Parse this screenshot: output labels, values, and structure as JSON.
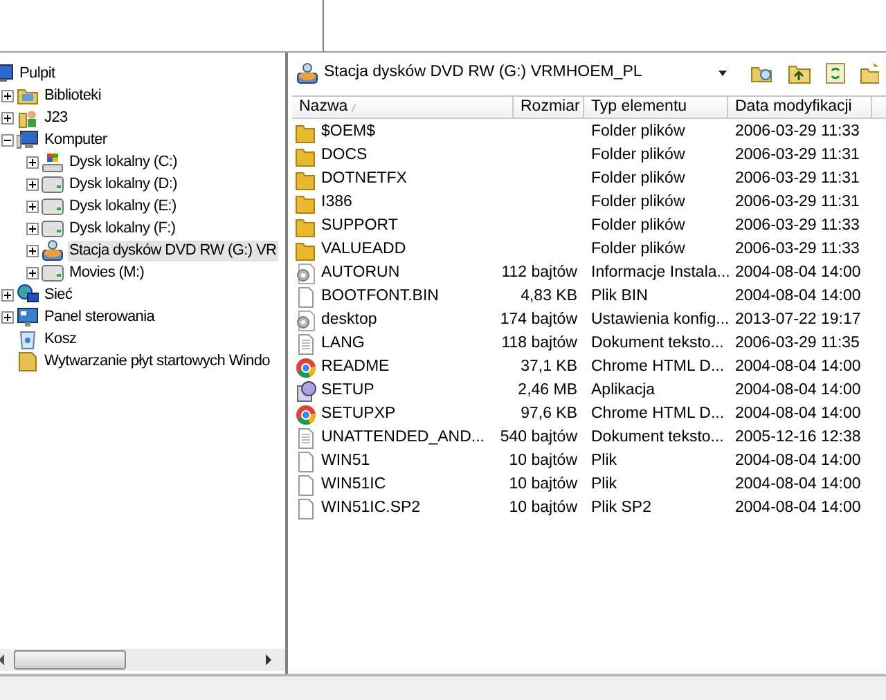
{
  "tree": [
    {
      "label": "Pulpit",
      "kind": "desktop",
      "selected": false,
      "children": [
        {
          "label": "Biblioteki",
          "kind": "library",
          "expanded": false,
          "selected": false
        },
        {
          "label": "J23",
          "kind": "user",
          "expanded": false,
          "selected": false
        },
        {
          "label": "Komputer",
          "kind": "computer",
          "expanded": true,
          "selected": false,
          "children": [
            {
              "label": "Dysk lokalny (C:)",
              "kind": "windrive",
              "expanded": false,
              "selected": false
            },
            {
              "label": "Dysk lokalny (D:)",
              "kind": "drive",
              "expanded": false,
              "selected": false
            },
            {
              "label": "Dysk lokalny (E:)",
              "kind": "drive",
              "expanded": false,
              "selected": false
            },
            {
              "label": "Dysk lokalny (F:)",
              "kind": "drive",
              "expanded": false,
              "selected": false
            },
            {
              "label": "Stacja dysków DVD RW (G:) VR",
              "kind": "dvd",
              "expanded": false,
              "selected": true
            },
            {
              "label": "Movies (M:)",
              "kind": "drive",
              "expanded": false,
              "selected": false
            }
          ]
        },
        {
          "label": "Sieć",
          "kind": "network",
          "expanded": false,
          "selected": false
        },
        {
          "label": "Panel sterowania",
          "kind": "control",
          "expanded": false,
          "selected": false
        },
        {
          "label": "Kosz",
          "kind": "trash",
          "selected": false
        },
        {
          "label": "Wytwarzanie płyt startowych Windo",
          "kind": "folder",
          "selected": false
        }
      ]
    }
  ],
  "location": {
    "value": "Stacja dysków DVD RW (G:) VRMHOEM_PL"
  },
  "columns": [
    "Nazwa",
    "Rozmiar",
    "Typ elementu",
    "Data modyfikacji"
  ],
  "rows": [
    {
      "kind": "folder",
      "name": "$OEM$",
      "type": "Folder plików",
      "date": "2006-03-29 11:33"
    },
    {
      "kind": "folder",
      "name": "DOCS",
      "type": "Folder plików",
      "date": "2006-03-29 11:31"
    },
    {
      "kind": "folder",
      "name": "DOTNETFX",
      "type": "Folder plików",
      "date": "2006-03-29 11:31"
    },
    {
      "kind": "folder",
      "name": "I386",
      "type": "Folder plików",
      "date": "2006-03-29 11:31"
    },
    {
      "kind": "folder",
      "name": "SUPPORT",
      "type": "Folder plików",
      "date": "2006-03-29 11:33"
    },
    {
      "kind": "folder",
      "name": "VALUEADD",
      "type": "Folder plików",
      "date": "2006-03-29 11:33"
    },
    {
      "kind": "config",
      "name": "AUTORUN",
      "size": "112 bajtów",
      "type": "Informacje Instala...",
      "date": "2004-08-04 14:00"
    },
    {
      "kind": "file",
      "name": "BOOTFONT.BIN",
      "size": "4,83 KB",
      "type": "Plik BIN",
      "date": "2004-08-04 14:00"
    },
    {
      "kind": "config",
      "name": "desktop",
      "size": "174 bajtów",
      "type": "Ustawienia konfig...",
      "date": "2013-07-22 19:17"
    },
    {
      "kind": "text",
      "name": "LANG",
      "size": "118 bajtów",
      "type": "Dokument teksto...",
      "date": "2006-03-29 11:35"
    },
    {
      "kind": "chrome",
      "name": "README",
      "size": "37,1 KB",
      "type": "Chrome HTML D...",
      "date": "2004-08-04 14:00"
    },
    {
      "kind": "setup",
      "name": "SETUP",
      "size": "2,46 MB",
      "type": "Aplikacja",
      "date": "2004-08-04 14:00"
    },
    {
      "kind": "chrome",
      "name": "SETUPXP",
      "size": "97,6 KB",
      "type": "Chrome HTML D...",
      "date": "2004-08-04 14:00"
    },
    {
      "kind": "text",
      "name": "UNATTENDED_AND...",
      "size": "540 bajtów",
      "type": "Dokument teksto...",
      "date": "2005-12-16 12:38"
    },
    {
      "kind": "file",
      "name": "WIN51",
      "size": "10 bajtów",
      "type": "Plik",
      "date": "2004-08-04 14:00"
    },
    {
      "kind": "file",
      "name": "WIN51IC",
      "size": "10 bajtów",
      "type": "Plik",
      "date": "2004-08-04 14:00"
    },
    {
      "kind": "file",
      "name": "WIN51IC.SP2",
      "size": "10 bajtów",
      "type": "Plik SP2",
      "date": "2004-08-04 14:00"
    }
  ]
}
